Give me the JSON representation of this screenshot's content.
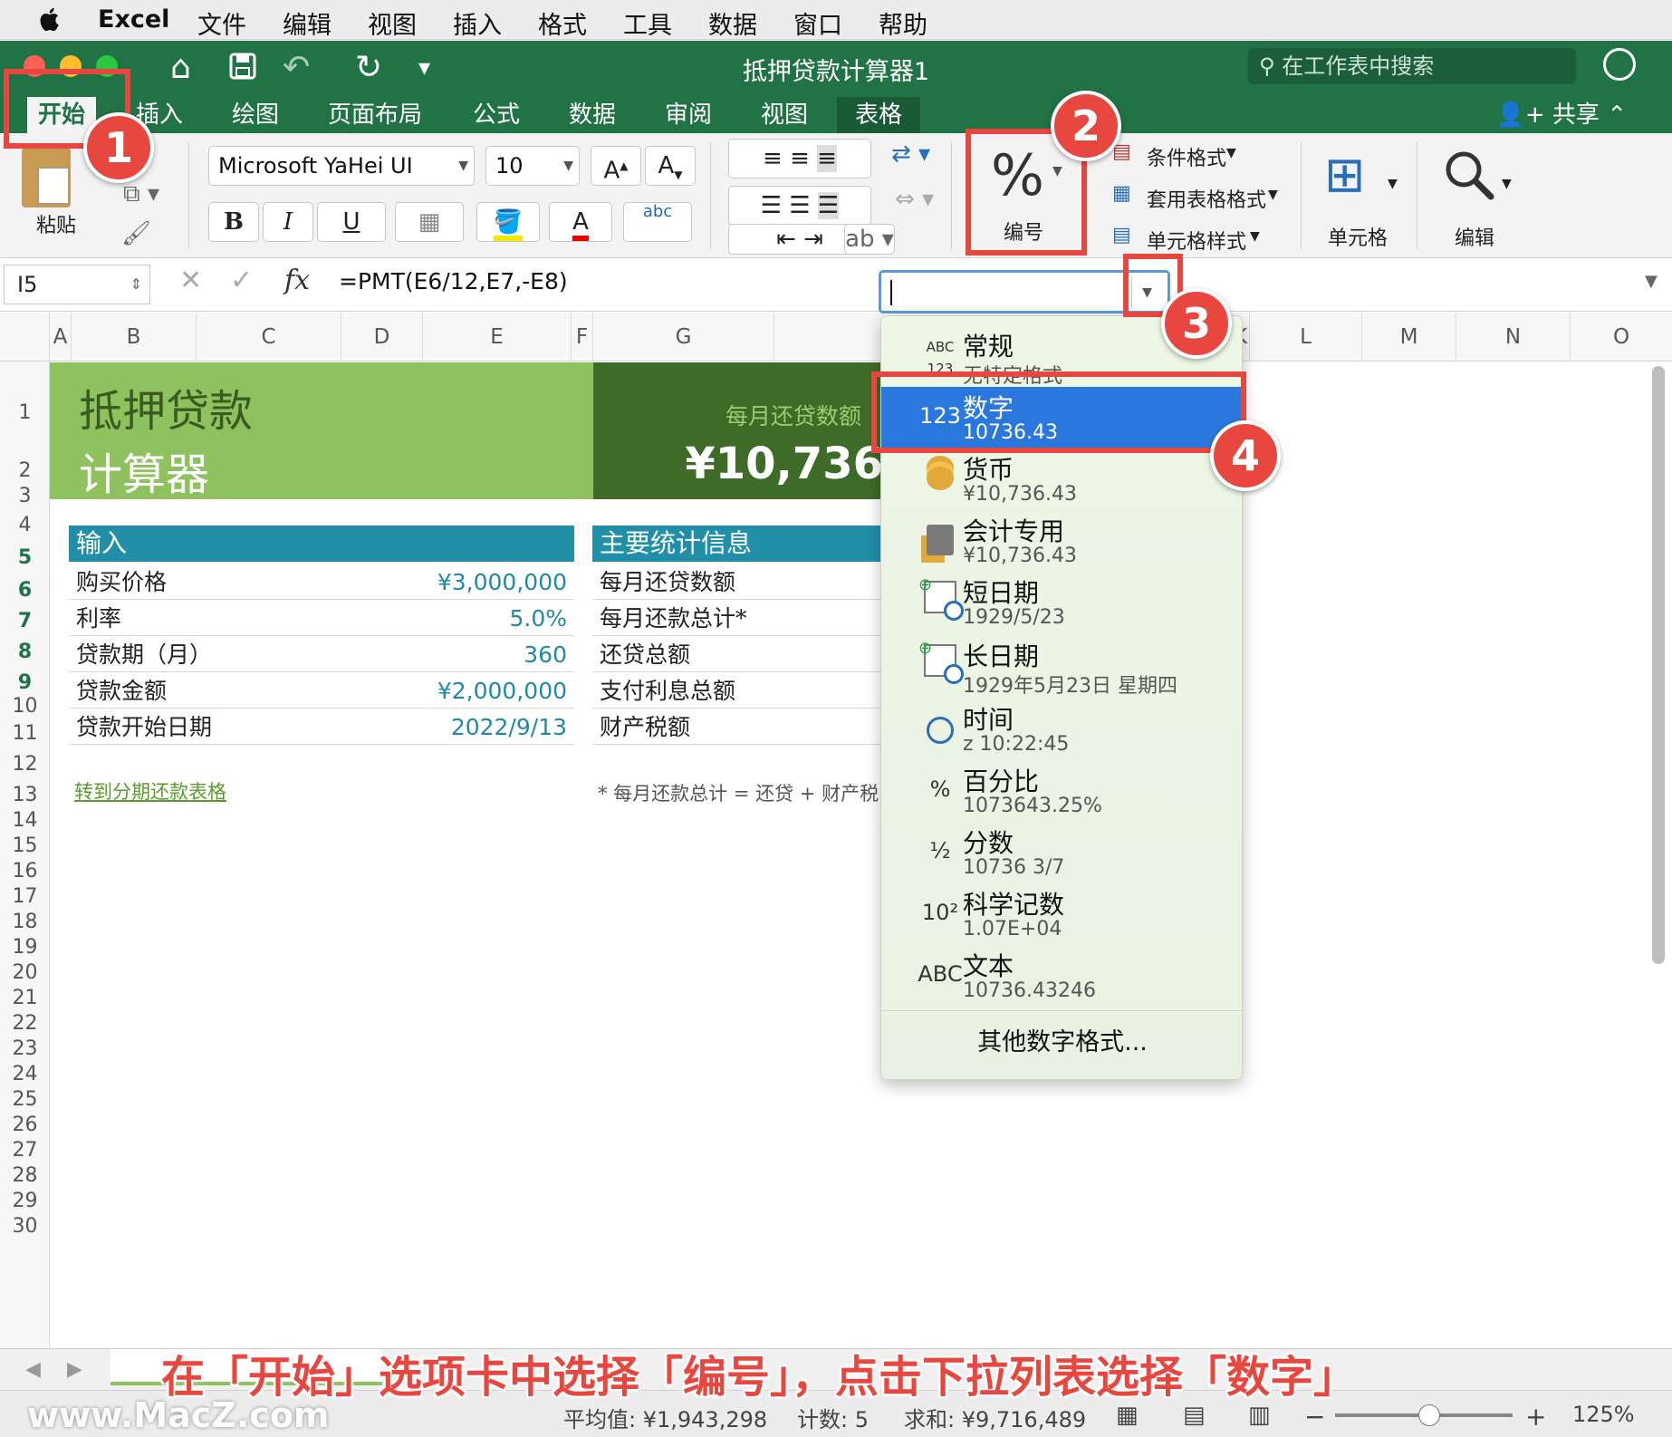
{
  "menubar": {
    "app": "Excel",
    "items": [
      "文件",
      "编辑",
      "视图",
      "插入",
      "格式",
      "工具",
      "数据",
      "窗口",
      "帮助"
    ]
  },
  "window": {
    "title": "抵押贷款计算器1",
    "search_placeholder": "在工作表中搜索"
  },
  "tabs": {
    "items": [
      "开始",
      "插入",
      "绘图",
      "页面布局",
      "公式",
      "数据",
      "审阅",
      "视图",
      "表格"
    ],
    "active": "开始",
    "share": "共享"
  },
  "ribbon": {
    "paste_label": "粘贴",
    "font_name": "Microsoft YaHei UI",
    "font_size": "10",
    "bold": "B",
    "italic": "I",
    "underline": "U",
    "grow_font": "A",
    "shrink_font": "A",
    "font_color": "A",
    "abc_label": "abc",
    "number_icon": "%",
    "number_label": "编号",
    "conditional_format": "条件格式",
    "format_as_table": "套用表格格式",
    "cell_styles": "单元格样式",
    "cells_label": "单元格",
    "editing_label": "编辑"
  },
  "formula_bar": {
    "name_box": "I5",
    "fx": "fx",
    "formula": "=PMT(E6/12,E7,-E8)"
  },
  "columns": [
    "A",
    "B",
    "C",
    "D",
    "E",
    "F",
    "G",
    "K",
    "L",
    "M",
    "N",
    "O"
  ],
  "rows": [
    "1",
    "2",
    "3",
    "4",
    "5",
    "6",
    "7",
    "8",
    "9",
    "10",
    "11",
    "12",
    "13",
    "14",
    "15",
    "16",
    "17",
    "18",
    "19",
    "20",
    "21",
    "22",
    "23",
    "24",
    "25",
    "26",
    "27",
    "28",
    "29",
    "30"
  ],
  "sheet": {
    "title_line1": "抵押贷款",
    "title_line2": "计算器",
    "payment_label": "每月还贷数额",
    "payment_value": "¥10,736",
    "input_header": "输入",
    "inputs": [
      {
        "label": "购买价格",
        "value": "¥3,000,000"
      },
      {
        "label": "利率",
        "value": "5.0%"
      },
      {
        "label": "贷款期（月）",
        "value": "360"
      },
      {
        "label": "贷款金额",
        "value": "¥2,000,000"
      },
      {
        "label": "贷款开始日期",
        "value": "2022/9/13"
      }
    ],
    "stats_header": "主要统计信息",
    "stats": [
      "每月还贷数额",
      "每月还款总计*",
      "还贷总额",
      "支付利息总额",
      "财产税额"
    ],
    "amortization_link": "转到分期还款表格",
    "footnote": "* 每月还款总计 = 还贷 + 财产税"
  },
  "format_menu": {
    "items": [
      {
        "icon": "ABC 123",
        "name": "常规",
        "example": "无特定格式"
      },
      {
        "icon": "123",
        "name": "数字",
        "example": "10736.43",
        "selected": true
      },
      {
        "icon": "coins",
        "name": "货币",
        "example": "¥10,736.43"
      },
      {
        "icon": "calculator",
        "name": "会计专用",
        "example": "¥10,736.43"
      },
      {
        "icon": "calendar-clock",
        "name": "短日期",
        "example": "1929/5/23"
      },
      {
        "icon": "calendar-clock",
        "name": "长日期",
        "example": "1929年5月23日 星期四"
      },
      {
        "icon": "clock",
        "name": "时间",
        "example": "z 10:22:45"
      },
      {
        "icon": "%",
        "name": "百分比",
        "example": "1073643.25%"
      },
      {
        "icon": "½",
        "name": "分数",
        "example": "10736 3/7"
      },
      {
        "icon": "10²",
        "name": "科学记数",
        "example": "1.07E+04"
      },
      {
        "icon": "ABC",
        "name": "文本",
        "example": "10736.43246"
      }
    ],
    "more": "其他数字格式..."
  },
  "callouts": [
    "1",
    "2",
    "3",
    "4"
  ],
  "caption": "在「开始」选项卡中选择「编号」，点击下拉列表选择「数字」",
  "watermark": "www.MacZ.com",
  "status": {
    "average": "平均值: ¥1,943,298",
    "count": "计数: 5",
    "sum": "求和: ¥9,716,489",
    "zoom": "125%"
  },
  "colors": {
    "excel_green": "#217346",
    "accent_red": "#e8473f",
    "selection_blue": "#2a78dd",
    "table_teal": "#218fa8",
    "banner_light": "#8ec25e",
    "banner_dark": "#3f6b28"
  }
}
